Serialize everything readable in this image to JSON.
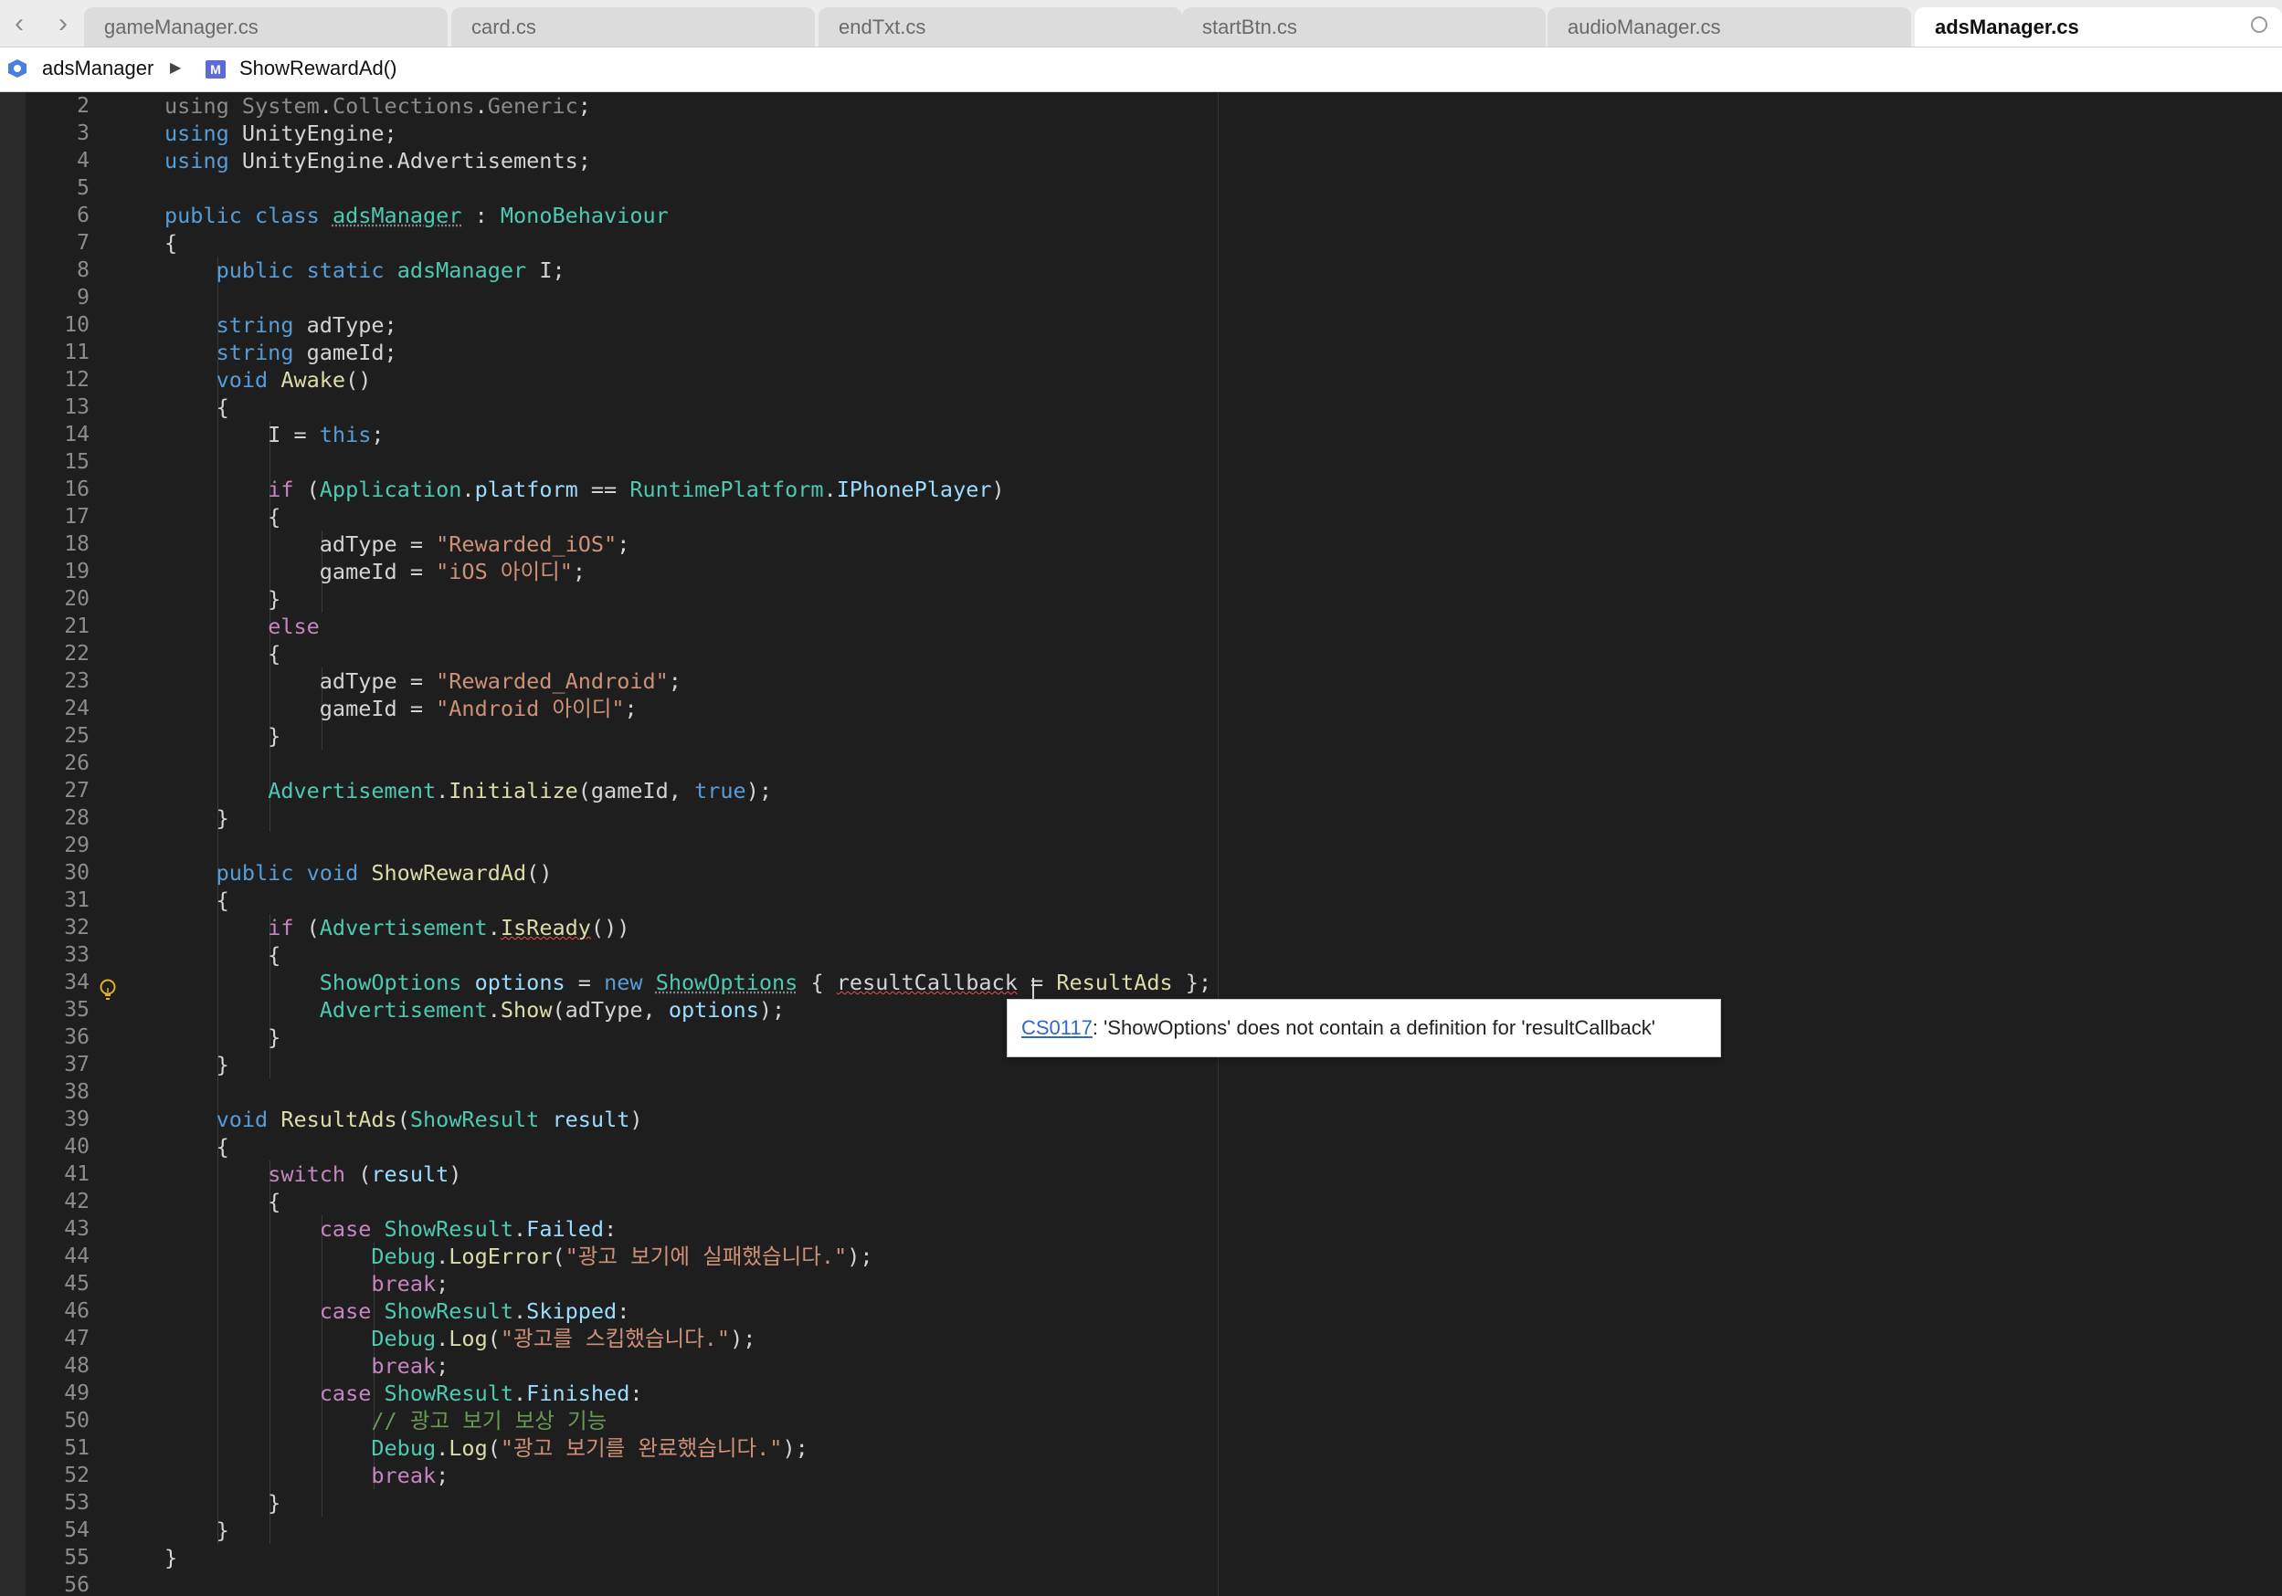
{
  "nav": {
    "back_glyph": "‹",
    "forward_glyph": "›"
  },
  "tabs": [
    {
      "label": "gameManager.cs"
    },
    {
      "label": "card.cs"
    },
    {
      "label": "endTxt.cs"
    },
    {
      "label": "startBtn.cs"
    },
    {
      "label": "audioManager.cs"
    },
    {
      "label": "adsManager.cs",
      "active": true
    }
  ],
  "breadcrumb": {
    "class_icon": "class-icon",
    "class_name": "adsManager",
    "separator": "▶",
    "method_icon_letter": "M",
    "method_name": "ShowRewardAd()"
  },
  "editor": {
    "lines": [
      {
        "n": "2",
        "code": "using System.Collections.Generic;"
      },
      {
        "n": "3",
        "code": "using UnityEngine;"
      },
      {
        "n": "4",
        "code": "using UnityEngine.Advertisements;"
      },
      {
        "n": "5",
        "code": ""
      },
      {
        "n": "6",
        "code": "public class adsManager : MonoBehaviour"
      },
      {
        "n": "7",
        "code": "{"
      },
      {
        "n": "8",
        "code": "    public static adsManager I;"
      },
      {
        "n": "9",
        "code": ""
      },
      {
        "n": "10",
        "code": "    string adType;"
      },
      {
        "n": "11",
        "code": "    string gameId;"
      },
      {
        "n": "12",
        "code": "    void Awake()"
      },
      {
        "n": "13",
        "code": "    {"
      },
      {
        "n": "14",
        "code": "        I = this;"
      },
      {
        "n": "15",
        "code": ""
      },
      {
        "n": "16",
        "code": "        if (Application.platform == RuntimePlatform.IPhonePlayer)"
      },
      {
        "n": "17",
        "code": "        {"
      },
      {
        "n": "18",
        "code": "            adType = \"Rewarded_iOS\";"
      },
      {
        "n": "19",
        "code": "            gameId = \"iOS 아이디\";"
      },
      {
        "n": "20",
        "code": "        }"
      },
      {
        "n": "21",
        "code": "        else"
      },
      {
        "n": "22",
        "code": "        {"
      },
      {
        "n": "23",
        "code": "            adType = \"Rewarded_Android\";"
      },
      {
        "n": "24",
        "code": "            gameId = \"Android 아이디\";"
      },
      {
        "n": "25",
        "code": "        }"
      },
      {
        "n": "26",
        "code": ""
      },
      {
        "n": "27",
        "code": "        Advertisement.Initialize(gameId, true);"
      },
      {
        "n": "28",
        "code": "    }"
      },
      {
        "n": "29",
        "code": ""
      },
      {
        "n": "30",
        "code": "    public void ShowRewardAd()"
      },
      {
        "n": "31",
        "code": "    {"
      },
      {
        "n": "32",
        "code": "        if (Advertisement.IsReady())"
      },
      {
        "n": "33",
        "code": "        {"
      },
      {
        "n": "34",
        "code": "            ShowOptions options = new ShowOptions { resultCallback = ResultAds };"
      },
      {
        "n": "35",
        "code": "            Advertisement.Show(adType, options);"
      },
      {
        "n": "36",
        "code": "        }"
      },
      {
        "n": "37",
        "code": "    }"
      },
      {
        "n": "38",
        "code": ""
      },
      {
        "n": "39",
        "code": "    void ResultAds(ShowResult result)"
      },
      {
        "n": "40",
        "code": "    {"
      },
      {
        "n": "41",
        "code": "        switch (result)"
      },
      {
        "n": "42",
        "code": "        {"
      },
      {
        "n": "43",
        "code": "            case ShowResult.Failed:"
      },
      {
        "n": "44",
        "code": "                Debug.LogError(\"광고 보기에 실패했습니다.\");"
      },
      {
        "n": "45",
        "code": "                break;"
      },
      {
        "n": "46",
        "code": "            case ShowResult.Skipped:"
      },
      {
        "n": "47",
        "code": "                Debug.Log(\"광고를 스킵했습니다.\");"
      },
      {
        "n": "48",
        "code": "                break;"
      },
      {
        "n": "49",
        "code": "            case ShowResult.Finished:"
      },
      {
        "n": "50",
        "code": "                // 광고 보기 보상 기능"
      },
      {
        "n": "51",
        "code": "                Debug.Log(\"광고 보기를 완료했습니다.\");"
      },
      {
        "n": "52",
        "code": "                break;"
      },
      {
        "n": "53",
        "code": "        }"
      },
      {
        "n": "54",
        "code": "    }"
      },
      {
        "n": "55",
        "code": "}"
      },
      {
        "n": "56",
        "code": ""
      }
    ],
    "lightbulb_icon": "lightbulb-icon"
  },
  "tooltip": {
    "error_code": "CS0117",
    "message": ": 'ShowOptions' does not contain a definition for 'resultCallback'"
  },
  "theme": {
    "keyword": "#569cd6",
    "control": "#c586c0",
    "type": "#4ec9b0",
    "function": "#dcdcaa",
    "string": "#ce9178",
    "comment": "#6a9955",
    "error_squiggle": "#f14c4c"
  }
}
